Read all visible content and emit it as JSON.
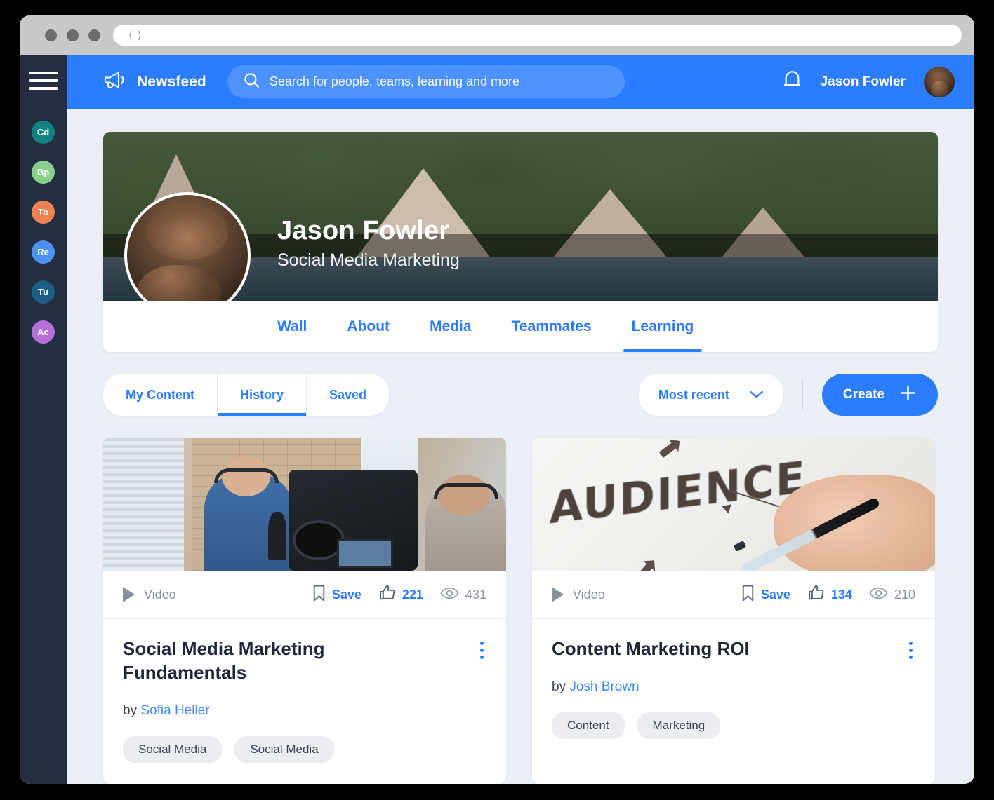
{
  "browser": {
    "nav_back_icon": "chevron-left-icon",
    "nav_forward_icon": "chevron-right-icon",
    "address_value": ""
  },
  "sidebar": {
    "menu_icon": "hamburger-menu-icon",
    "avatars": [
      {
        "initials": "Cd",
        "color": "#10827f"
      },
      {
        "initials": "Bp",
        "color": "#86d08a"
      },
      {
        "initials": "To",
        "color": "#ed8352"
      },
      {
        "initials": "Re",
        "color": "#4d92ef"
      },
      {
        "initials": "Tu",
        "color": "#1c5e86"
      },
      {
        "initials": "Ac",
        "color": "#b470d8"
      }
    ]
  },
  "topbar": {
    "brand_icon": "megaphone-icon",
    "brand_label": "Newsfeed",
    "search": {
      "icon": "search-icon",
      "placeholder": "Search for people, teams, learning and more",
      "value": ""
    },
    "notifications_icon": "bell-icon",
    "user_name": "Jason Fowler",
    "user_avatar": "user-avatar"
  },
  "profile": {
    "cover_image": "tropical-huts-cover-photo",
    "avatar": "profile-photo",
    "name": "Jason Fowler",
    "role": "Social Media Marketing",
    "tabs": [
      {
        "label": "Wall",
        "active": false
      },
      {
        "label": "About",
        "active": false
      },
      {
        "label": "Media",
        "active": false
      },
      {
        "label": "Teammates",
        "active": false
      },
      {
        "label": "Learning",
        "active": true
      }
    ]
  },
  "toolbar": {
    "segments": [
      {
        "label": "My Content",
        "active": false
      },
      {
        "label": "History",
        "active": true
      },
      {
        "label": "Saved",
        "active": false
      }
    ],
    "sort": {
      "value": "Most recent",
      "chevron_icon": "chevron-down-icon"
    },
    "create_label": "Create",
    "create_icon": "plus-icon"
  },
  "cards": [
    {
      "thumbnail": "podcast-studio-video-thumbnail",
      "type_icon": "play-icon",
      "type_label": "Video",
      "save_icon": "bookmark-icon",
      "save_label": "Save",
      "like_icon": "thumbs-up-icon",
      "likes": "221",
      "view_icon": "eye-icon",
      "views": "431",
      "title": "Social Media Marketing Fundamentals",
      "by_prefix": "by",
      "author": "Sofia Heller",
      "tags": [
        "Social Media",
        "Social Media"
      ],
      "menu_icon": "kebab-menu-icon"
    },
    {
      "thumbnail": "whiteboard-audience-video-thumbnail",
      "type_icon": "play-icon",
      "type_label": "Video",
      "save_icon": "bookmark-icon",
      "save_label": "Save",
      "like_icon": "thumbs-up-icon",
      "likes": "134",
      "view_icon": "eye-icon",
      "views": "210",
      "title": "Content Marketing ROI",
      "by_prefix": "by",
      "author": "Josh Brown",
      "tags": [
        "Content",
        "Marketing"
      ],
      "menu_icon": "kebab-menu-icon"
    }
  ],
  "colors": {
    "accent": "#2b7cff",
    "sidebar": "#252d42",
    "background": "#eceff5",
    "title": "#202637",
    "muted": "#8d949f"
  }
}
